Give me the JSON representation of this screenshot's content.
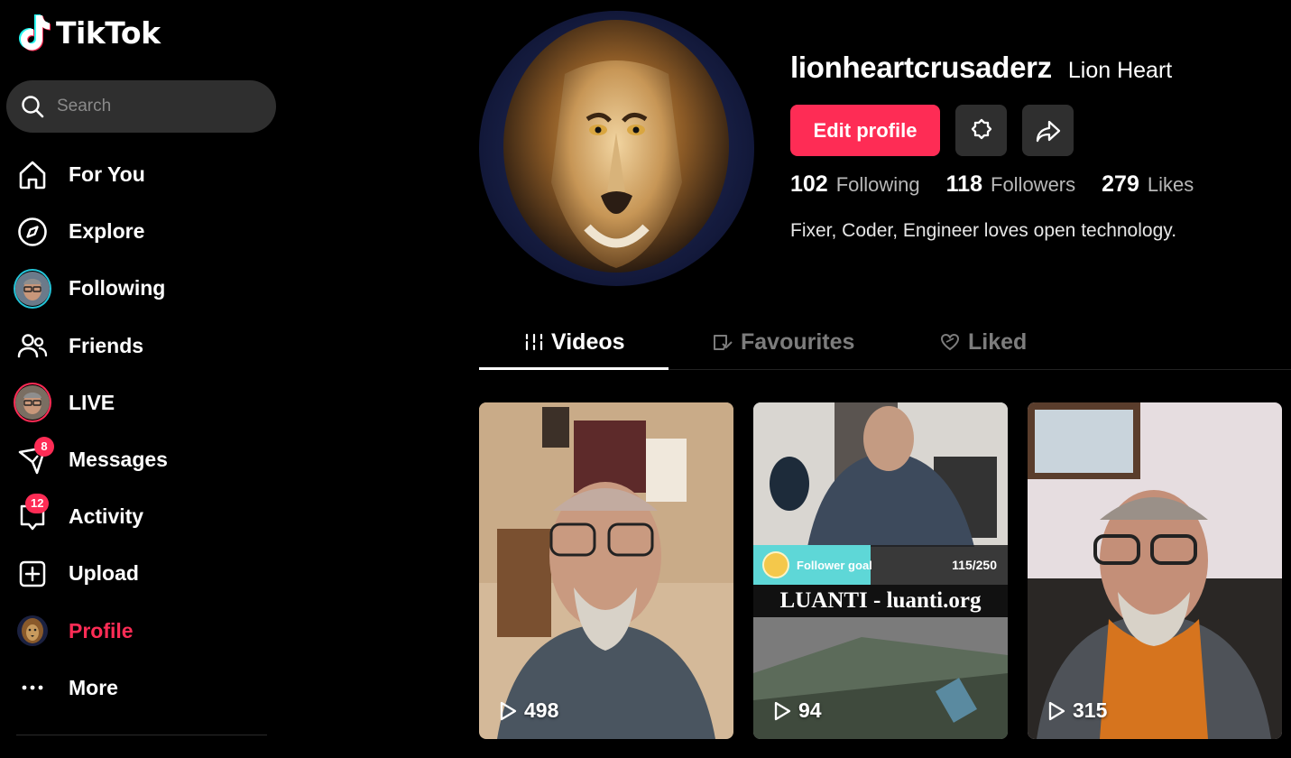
{
  "app": {
    "name": "TikTok",
    "brand_color": "#fe2c55"
  },
  "search": {
    "placeholder": "Search"
  },
  "nav": [
    {
      "label": "For You",
      "icon": "home-icon"
    },
    {
      "label": "Explore",
      "icon": "compass-icon"
    },
    {
      "label": "Following",
      "icon": "following-avatar"
    },
    {
      "label": "Friends",
      "icon": "friends-icon"
    },
    {
      "label": "LIVE",
      "icon": "live-avatar"
    },
    {
      "label": "Messages",
      "icon": "messages-icon",
      "badge": "8"
    },
    {
      "label": "Activity",
      "icon": "activity-icon",
      "badge": "12"
    },
    {
      "label": "Upload",
      "icon": "upload-icon"
    },
    {
      "label": "Profile",
      "icon": "profile-avatar",
      "active": true
    },
    {
      "label": "More",
      "icon": "more-icon"
    }
  ],
  "profile": {
    "username": "lionheartcrusaderz",
    "nickname": "Lion Heart",
    "edit_label": "Edit profile",
    "stats": {
      "following": {
        "count": "102",
        "label": "Following"
      },
      "followers": {
        "count": "118",
        "label": "Followers"
      },
      "likes": {
        "count": "279",
        "label": "Likes"
      }
    },
    "bio": "Fixer, Coder, Engineer loves open technology."
  },
  "tabs": [
    {
      "label": "Videos",
      "active": true
    },
    {
      "label": "Favourites"
    },
    {
      "label": "Liked"
    }
  ],
  "videos": [
    {
      "views": "498"
    },
    {
      "views": "94",
      "goal_label": "Follower goal",
      "goal_count": "115/250",
      "goal_progress": 0.46,
      "banner": "LUANTI - luanti.org"
    },
    {
      "views": "315"
    }
  ]
}
